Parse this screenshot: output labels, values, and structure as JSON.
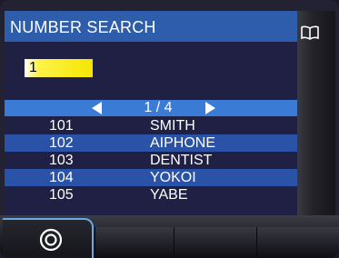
{
  "header": {
    "title": "NUMBER SEARCH"
  },
  "side_icon": "open-book-icon",
  "search": {
    "value": "1"
  },
  "pager": {
    "text": "1 / 4"
  },
  "entries": [
    {
      "number": "101",
      "name": "SMITH"
    },
    {
      "number": "102",
      "name": "AIPHONE"
    },
    {
      "number": "103",
      "name": "DENTIST"
    },
    {
      "number": "104",
      "name": "YOKOI"
    },
    {
      "number": "105",
      "name": "YABE"
    }
  ],
  "softkeys": [
    {
      "icon": "target-icon"
    },
    {
      "icon": ""
    },
    {
      "icon": ""
    },
    {
      "icon": ""
    }
  ],
  "colors": {
    "title_bar": "#2d5dab",
    "list_bg": "#1f2043",
    "row_highlight": "#2a52a6",
    "pager_bar": "#3a7bd5",
    "input_bg": "#f5e600",
    "active_softkey_border": "#6aa9e6"
  }
}
